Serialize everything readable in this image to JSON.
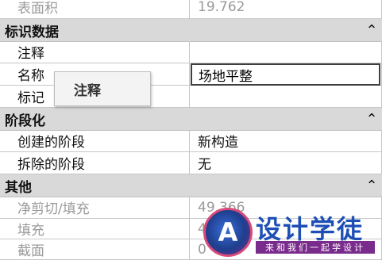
{
  "rows": [
    {
      "kind": "prop",
      "label": "表面积",
      "value": "19.762",
      "dim": true
    },
    {
      "kind": "header",
      "title": "标识数据",
      "chevron": "⌃"
    },
    {
      "kind": "prop",
      "label": "注释",
      "value": ""
    },
    {
      "kind": "prop",
      "label": "名称",
      "value": "场地平整"
    },
    {
      "kind": "prop",
      "label": "标记",
      "value": ""
    },
    {
      "kind": "header",
      "title": "阶段化",
      "chevron": "⌃"
    },
    {
      "kind": "prop",
      "label": "创建的阶段",
      "value": "新构造"
    },
    {
      "kind": "prop",
      "label": "拆除的阶段",
      "value": "无"
    },
    {
      "kind": "header",
      "title": "其他",
      "chevron": "⌃"
    },
    {
      "kind": "prop",
      "label": "净剪切/填充",
      "value": "49.366",
      "dim": true
    },
    {
      "kind": "prop",
      "label": "填充",
      "value": "4",
      "dim": true
    },
    {
      "kind": "prop",
      "label": "截面",
      "value": "0",
      "dim": true
    }
  ],
  "tooltip": {
    "text": "注释"
  },
  "name_value": "场地平整",
  "watermark": {
    "logo_glyph": "A",
    "brand": "设计学徒",
    "slogan": "来和我们一起学设计"
  }
}
